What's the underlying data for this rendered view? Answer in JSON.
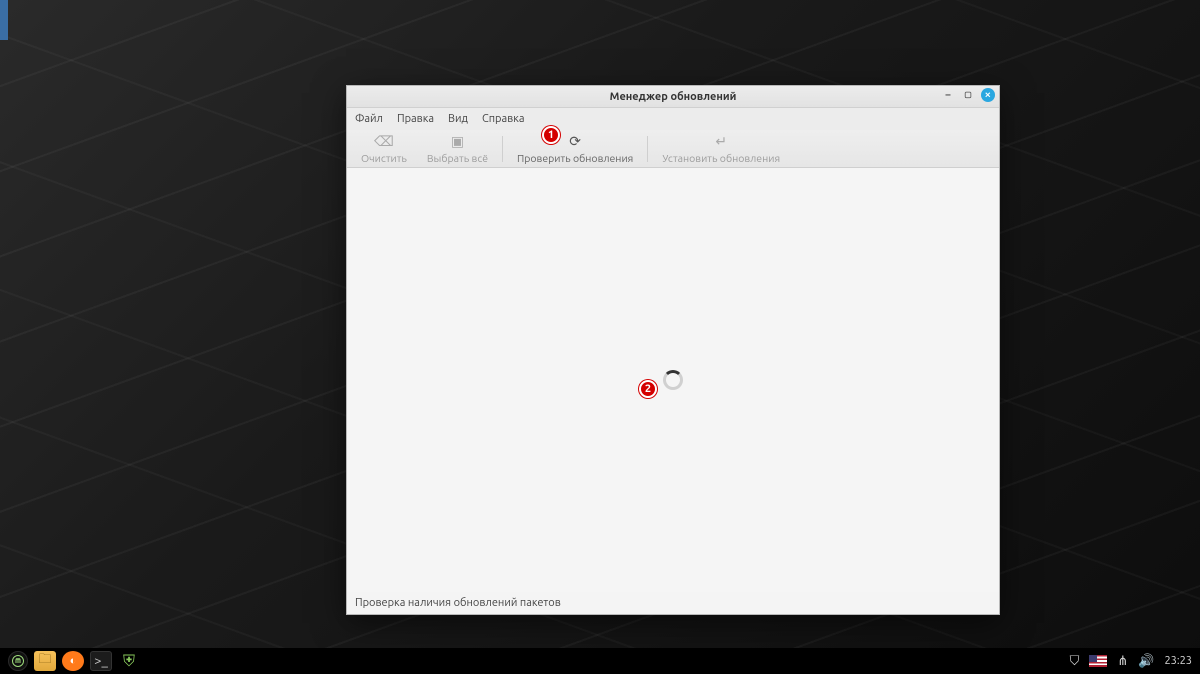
{
  "window": {
    "title": "Менеджер обновлений",
    "menu": {
      "file": "Файл",
      "edit": "Правка",
      "view": "Вид",
      "help": "Справка"
    },
    "toolbar": {
      "clear": "Очистить",
      "select_all": "Выбрать всё",
      "check": "Проверить обновления",
      "install": "Установить обновления"
    },
    "status": "Проверка наличия обновлений пакетов"
  },
  "annotations": {
    "b1": "1",
    "b2": "2"
  },
  "tray": {
    "clock": "23:23"
  }
}
